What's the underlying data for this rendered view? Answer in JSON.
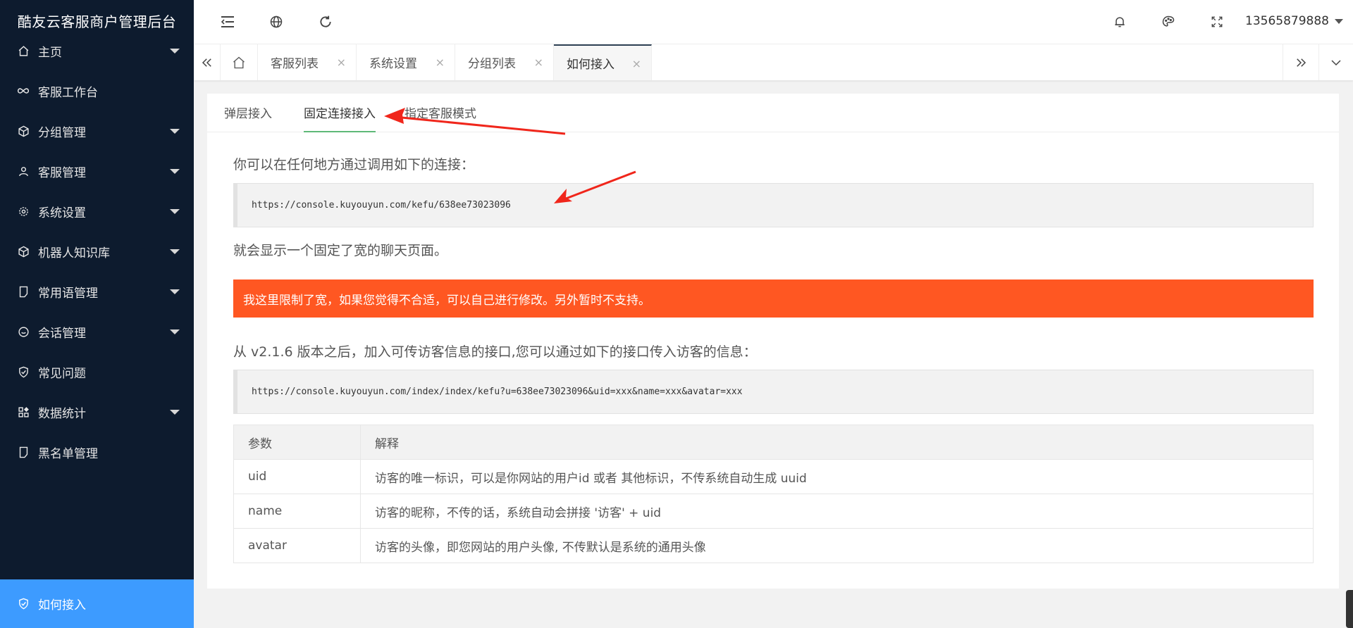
{
  "brand": "酷友云客服商户管理后台",
  "sidebar": {
    "items": [
      {
        "label": "主页",
        "icon": "home-icon",
        "has_caret": true
      },
      {
        "label": "客服工作台",
        "icon": "infinity-icon",
        "has_caret": false
      },
      {
        "label": "分组管理",
        "icon": "cube-icon",
        "has_caret": true
      },
      {
        "label": "客服管理",
        "icon": "user-icon",
        "has_caret": true
      },
      {
        "label": "系统设置",
        "icon": "gear-icon",
        "has_caret": true
      },
      {
        "label": "机器人知识库",
        "icon": "cube-icon",
        "has_caret": true
      },
      {
        "label": "常用语管理",
        "icon": "note-icon",
        "has_caret": true
      },
      {
        "label": "会话管理",
        "icon": "chat-icon",
        "has_caret": true
      },
      {
        "label": "常见问题",
        "icon": "shield-icon",
        "has_caret": false
      },
      {
        "label": "数据统计",
        "icon": "apps-icon",
        "has_caret": true
      },
      {
        "label": "黑名单管理",
        "icon": "note-icon",
        "has_caret": false
      },
      {
        "label": "如何接入",
        "icon": "shield-icon",
        "has_caret": false
      }
    ]
  },
  "topbar": {
    "username": "13565879888"
  },
  "tabs": [
    {
      "label": "客服列表"
    },
    {
      "label": "系统设置"
    },
    {
      "label": "分组列表"
    },
    {
      "label": "如何接入"
    }
  ],
  "tab_close": "×",
  "subtabs": [
    "弹层接入",
    "固定连接接入",
    "指定客服模式"
  ],
  "content": {
    "intro": "你可以在任何地方通过调用如下的连接：",
    "url1": "https://console.kuyouyun.com/kefu/638ee73023096",
    "desc": "就会显示一个固定了宽的聊天页面。",
    "notice": "我这里限制了宽，如果您觉得不合适，可以自己进行修改。另外暂时不支持。",
    "version_note": "从 v2.1.6 版本之后，加入可传访客信息的接口,您可以通过如下的接口传入访客的信息：",
    "url2": "https://console.kuyouyun.com/index/index/kefu?u=638ee73023096&uid=xxx&name=xxx&avatar=xxx"
  },
  "table": {
    "headers": [
      "参数",
      "解释"
    ],
    "rows": [
      [
        "uid",
        "访客的唯一标识，可以是你网站的用户id 或者 其他标识，不传系统自动生成 uuid"
      ],
      [
        "name",
        "访客的昵称，不传的话，系统自动会拼接 '访客' + uid"
      ],
      [
        "avatar",
        "访客的头像，即您网站的用户头像, 不传默认是系统的通用头像"
      ]
    ]
  },
  "colors": {
    "sidebar_bg": "#0d1b2e",
    "active_menu": "#3d9bff",
    "notice_bg": "#ff5722",
    "active_subtab_underline": "#5fb878",
    "annotation_arrow": "#f0261b"
  }
}
